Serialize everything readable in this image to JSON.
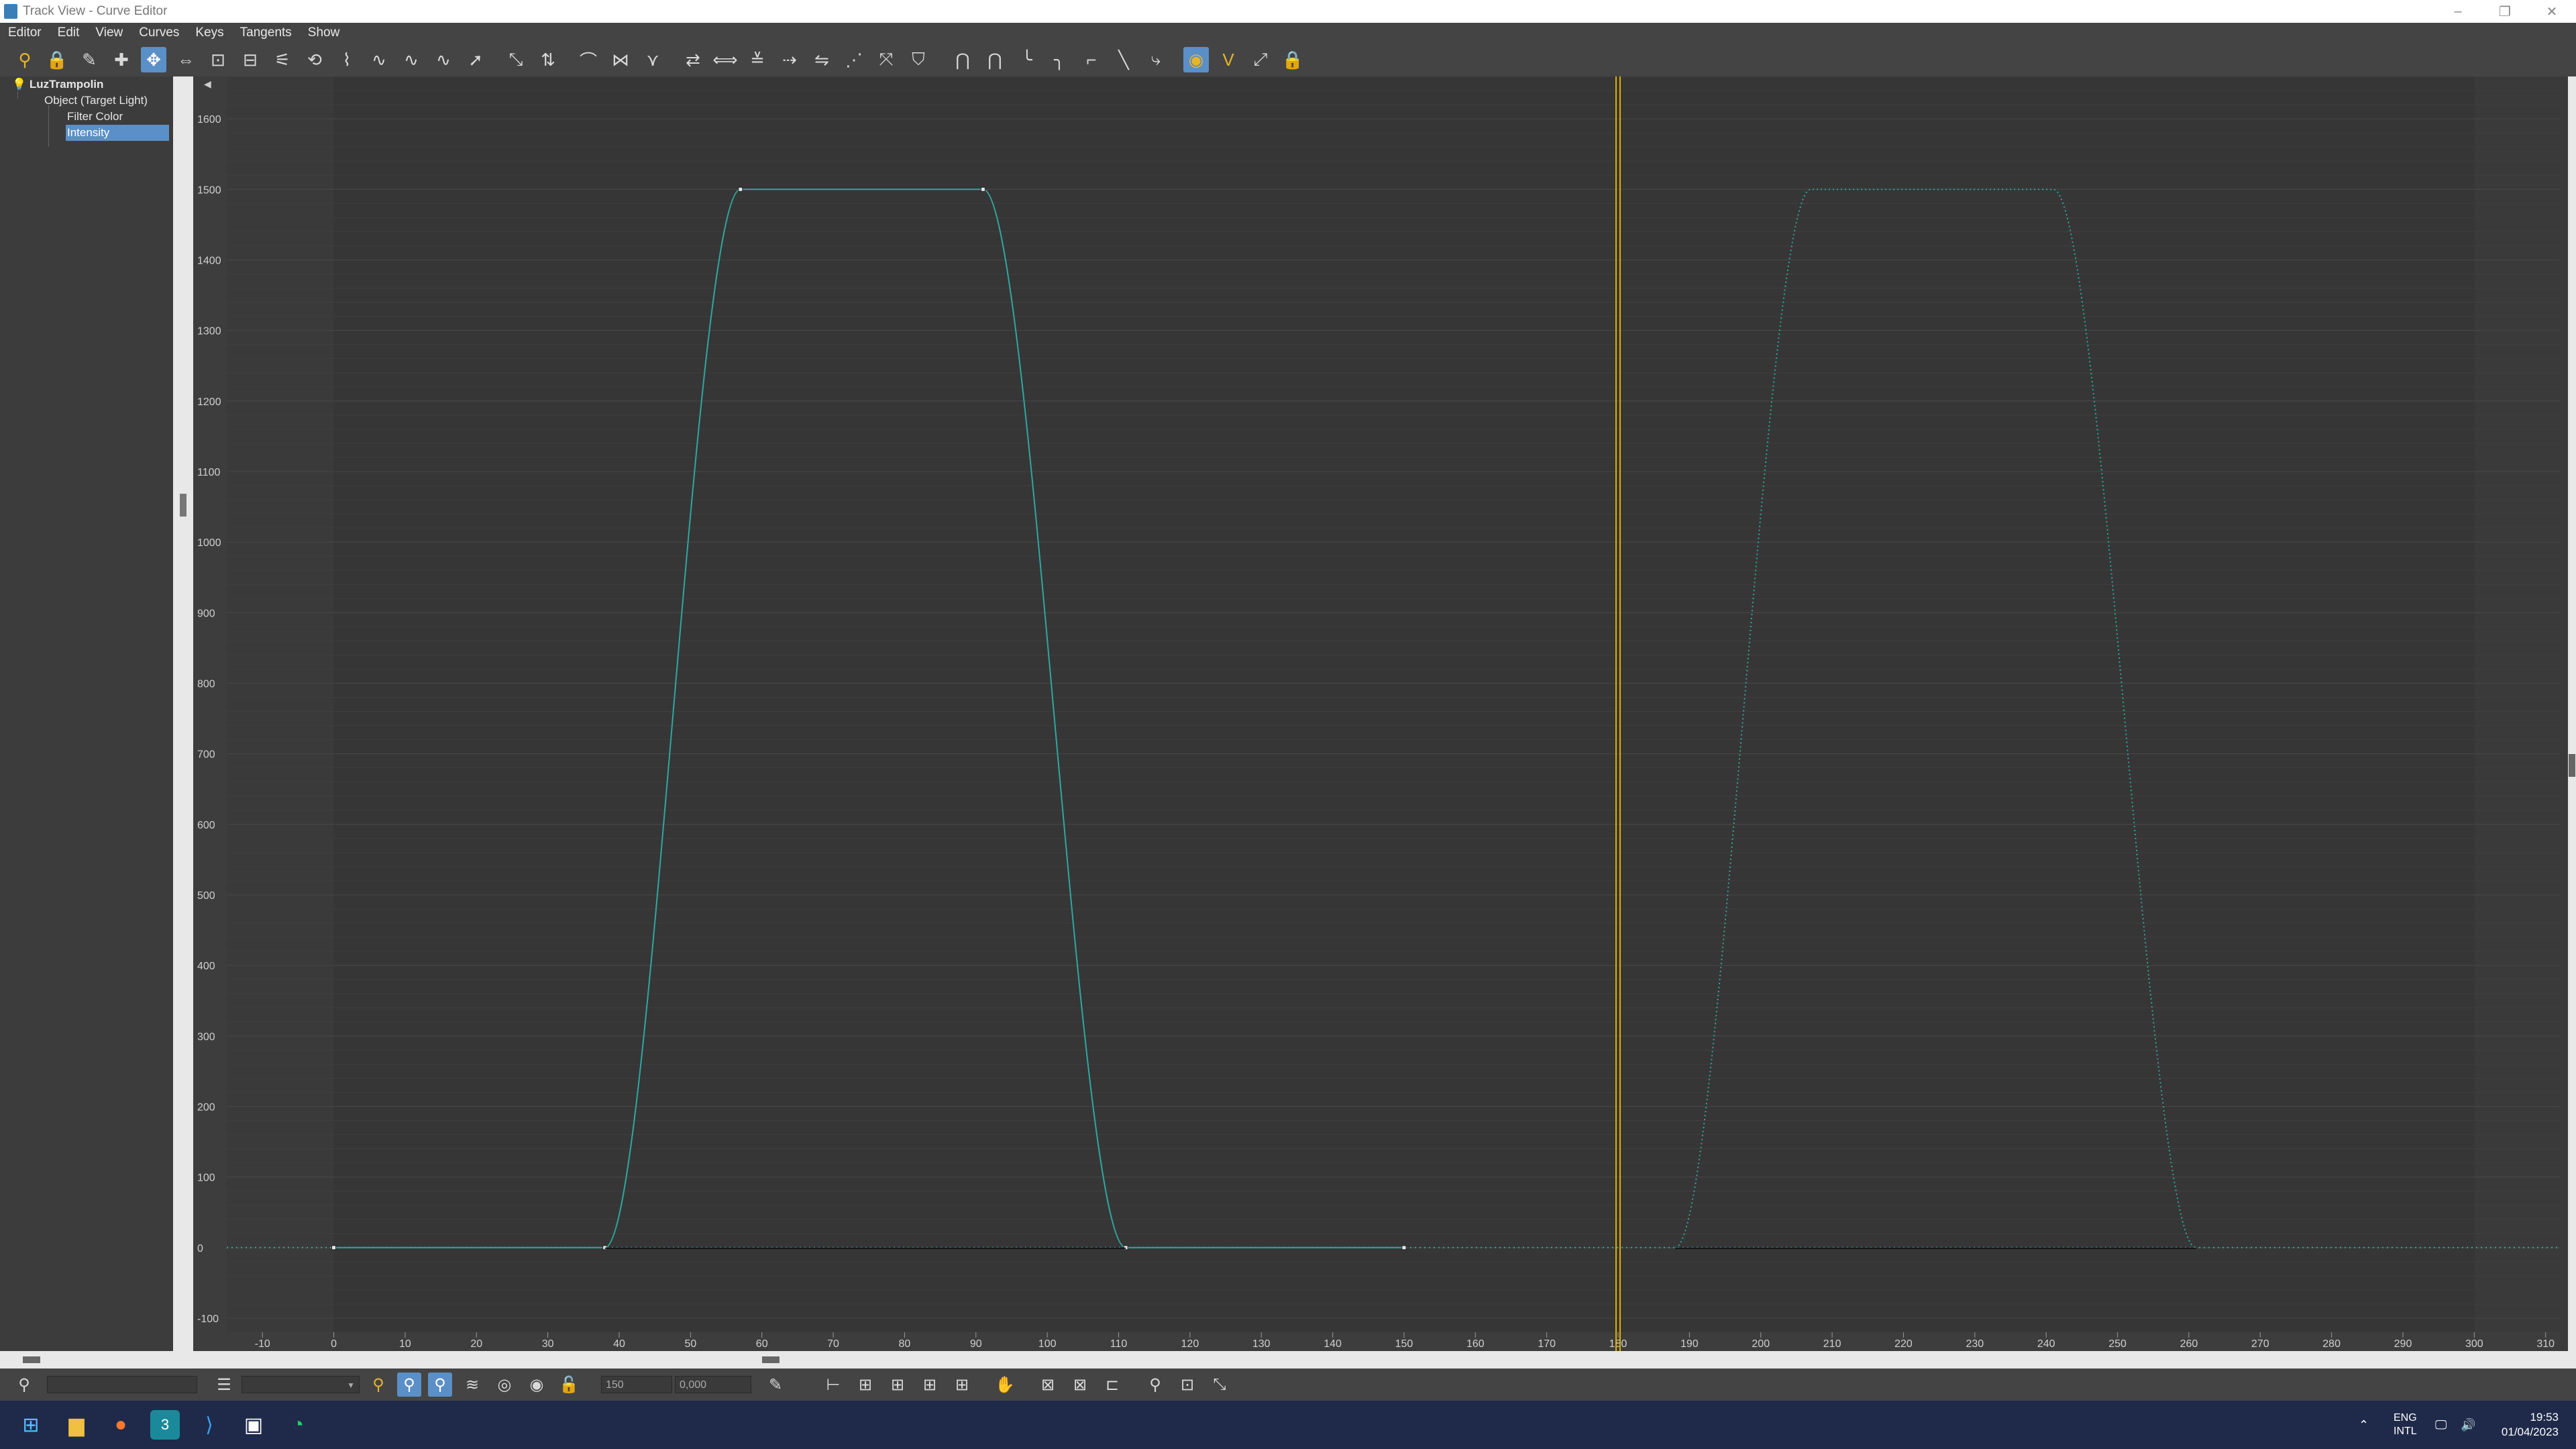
{
  "window": {
    "title": "Track View - Curve Editor"
  },
  "menu": {
    "items": [
      "Editor",
      "Edit",
      "View",
      "Curves",
      "Keys",
      "Tangents",
      "Show"
    ]
  },
  "tree": {
    "root": "LuzTrampolin",
    "object": "Object (Target Light)",
    "tracks": [
      "Filter Color",
      "Intensity"
    ],
    "selected": "Intensity"
  },
  "bottom": {
    "frame_value": "150",
    "value_field": "0,000"
  },
  "taskbar": {
    "lang_line1": "ENG",
    "lang_line2": "INTL",
    "time": "19:53",
    "date": "01/04/2023"
  },
  "colors": {
    "curve": "#2fa7a0",
    "time_slider": "#e0b000",
    "selection": "#5b8fc7"
  },
  "chart_data": {
    "type": "line",
    "x_ticks": [
      -10,
      0,
      10,
      20,
      30,
      40,
      50,
      60,
      70,
      80,
      90,
      100,
      110,
      120,
      130,
      140,
      150,
      160,
      170,
      180,
      190,
      200,
      210,
      220,
      230,
      240,
      250,
      260,
      270,
      280,
      290,
      300,
      310
    ],
    "y_ticks": [
      1600,
      1500,
      1400,
      1300,
      1200,
      1100,
      1000,
      900,
      800,
      700,
      600,
      500,
      400,
      300,
      200,
      100,
      0,
      -100
    ],
    "xlim": [
      -15,
      312
    ],
    "ylim": [
      -120,
      1660
    ],
    "current_frame": 180,
    "series": [
      {
        "keys": [
          [
            0,
            0
          ],
          [
            38,
            0
          ],
          [
            57,
            1500
          ],
          [
            91,
            1500
          ],
          [
            111,
            0
          ],
          [
            150,
            0
          ]
        ],
        "style": "solid"
      },
      {
        "keys": [
          [
            188,
            0
          ],
          [
            207,
            1500
          ],
          [
            241,
            1500
          ],
          [
            261,
            0
          ]
        ],
        "style": "dotted"
      }
    ]
  }
}
